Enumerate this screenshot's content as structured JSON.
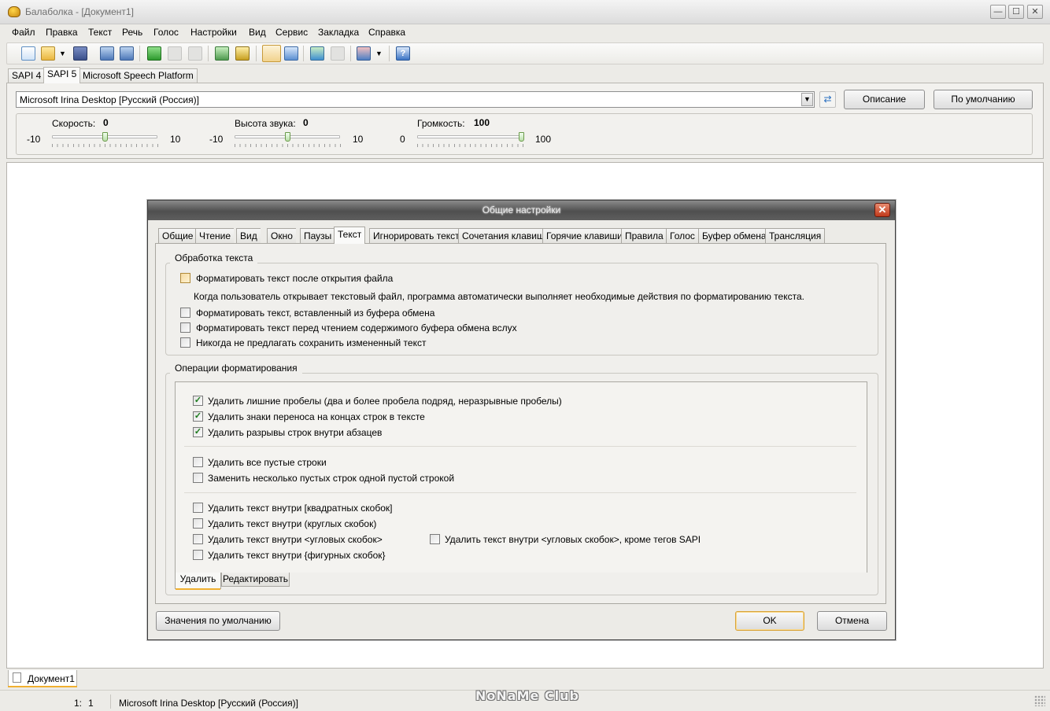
{
  "window": {
    "title": "Балаболка - [Документ1]",
    "controls": {
      "minimize": "—",
      "maximize": "☐",
      "close": "✕"
    }
  },
  "menu": [
    "Файл",
    "Правка",
    "Текст",
    "Речь",
    "Голос",
    "Настройки",
    "Вид",
    "Сервис",
    "Закладка",
    "Справка"
  ],
  "toolbar": {
    "icons": [
      "new-document-icon",
      "open-folder-icon",
      "dropdown-arrow-icon",
      "save-icon",
      "convert-icon",
      "batch-convert-icon",
      "play-icon",
      "pause-icon",
      "stop-icon",
      "read-clipboard-icon",
      "export-clipboard-icon",
      "settings-icon",
      "spell-check-icon",
      "split-icon",
      "join-icon",
      "voice-select-icon",
      "dropdown-arrow-icon",
      "help-icon"
    ]
  },
  "sapi_tabs": {
    "items": [
      "SAPI 4",
      "SAPI 5",
      "Microsoft Speech Platform"
    ],
    "active": "SAPI 5"
  },
  "voice": {
    "selected": "Microsoft Irina Desktop [Русский (Россия)]",
    "describe_label": "Описание",
    "default_label": "По умолчанию"
  },
  "sliders": {
    "rate": {
      "label": "Скорость:",
      "value": "0",
      "min": "-10",
      "max": "10"
    },
    "pitch": {
      "label": "Высота звука:",
      "value": "0",
      "min": "-10",
      "max": "10"
    },
    "volume": {
      "label": "Громкость:",
      "value": "100",
      "min": "0",
      "max": "100"
    }
  },
  "dialog": {
    "title": "Общие настройки",
    "close": "✕",
    "tabs": [
      "Общие",
      "Чтение",
      "Вид",
      "Окно",
      "Паузы",
      "Текст",
      "Игнорировать текст",
      "Сочетания клавиш",
      "Горячие клавиши",
      "Правила",
      "Голос",
      "Буфер обмена",
      "Трансляция"
    ],
    "active_tab": "Текст",
    "processing": {
      "title": "Обработка текста",
      "format_after_open": {
        "label": "Форматировать текст после открытия файла",
        "checked": false
      },
      "hint": "Когда пользователь открывает текстовый файл, программа автоматически выполняет необходимые действия по форматированию текста.",
      "format_pasted": {
        "label": "Форматировать текст, вставленный из буфера обмена",
        "checked": false
      },
      "format_before_reading": {
        "label": "Форматировать текст перед чтением содержимого буфера обмена вслух",
        "checked": false
      },
      "never_offer_save": {
        "label": "Никогда не предлагать сохранить измененный текст",
        "checked": false
      }
    },
    "operations": {
      "title": "Операции форматирования",
      "remove_extra_spaces": {
        "label": "Удалить лишние пробелы (два и более пробела подряд, неразрывные пробелы)",
        "checked": true
      },
      "remove_hyphens": {
        "label": "Удалить знаки переноса на концах строк в тексте",
        "checked": true
      },
      "remove_line_breaks": {
        "label": "Удалить разрывы строк внутри абзацев",
        "checked": true
      },
      "remove_empty_lines": {
        "label": "Удалить все пустые строки",
        "checked": false
      },
      "replace_empty_lines": {
        "label": "Заменить несколько пустых строк одной пустой строкой",
        "checked": false
      },
      "remove_square": {
        "label": "Удалить текст внутри [квадратных скобок]",
        "checked": false
      },
      "remove_round": {
        "label": "Удалить текст внутри (круглых скобок)",
        "checked": false
      },
      "remove_angle": {
        "label": "Удалить текст внутри <угловых скобок>",
        "checked": false
      },
      "remove_angle_except_sapi": {
        "label": "Удалить текст внутри <угловых скобок>, кроме тегов SAPI",
        "checked": false
      },
      "remove_curly": {
        "label": "Удалить текст внутри {фигурных скобок}",
        "checked": false
      },
      "subtabs": [
        "Удалить",
        "Редактировать"
      ],
      "active_subtab": "Удалить"
    },
    "defaults_label": "Значения по умолчанию",
    "ok_label": "OK",
    "cancel_label": "Отмена"
  },
  "document_tab": "Документ1",
  "status": {
    "line": "1:",
    "col": "1",
    "voice": "Microsoft Irina Desktop [Русский (Россия)]",
    "watermark": "NoNaMe Club"
  }
}
